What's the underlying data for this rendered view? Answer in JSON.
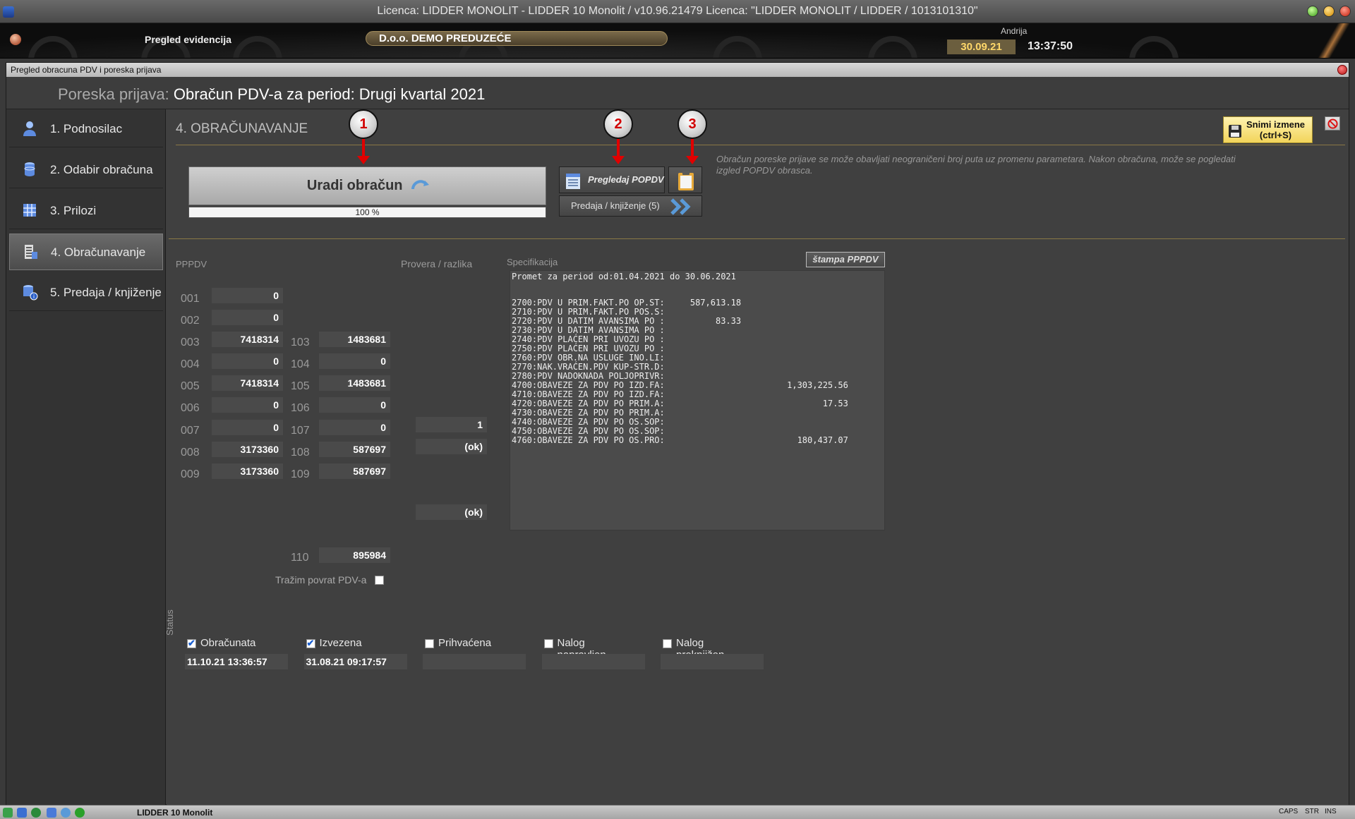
{
  "titlebar": {
    "title": "Licenca: LIDDER MONOLIT - LIDDER 10 Monolit / v10.96.21479 Licenca: \"LIDDER MONOLIT / LIDDER / 1013101310\""
  },
  "header": {
    "section": "Pregled evidencija",
    "company": "D.o.o. DEMO PREDUZEĆE",
    "user": "Andrija",
    "date": "30.09.21",
    "time": "13:37:50"
  },
  "window": {
    "title": "Pregled obracuna PDV i poreska prijava",
    "heading_label": "Poreska prijava:",
    "heading_value": "Obračun PDV-a za period: Drugi kvartal 2021"
  },
  "sidebar": {
    "items": [
      {
        "label": "1. Podnosilac",
        "icon": "person-icon"
      },
      {
        "label": "2. Odabir obračuna",
        "icon": "database-icon"
      },
      {
        "label": "3. Prilozi",
        "icon": "table-icon"
      },
      {
        "label": "4. Obračunavanje",
        "icon": "calculator-list-icon"
      },
      {
        "label": "5. Predaja / knjiženje",
        "icon": "database-info-icon"
      }
    ]
  },
  "main": {
    "section_title": "4. OBRAČUNAVANJE",
    "save_label_1": "Snimi izmene",
    "save_label_2": "(ctrl+S)",
    "calc_button": "Uradi obračun",
    "progress_text": "100 %",
    "progress": 1.0,
    "review_button": "Pregledaj POPDV",
    "submit_button": "Predaja / knjiženje (5)",
    "info_line1": "Obračun poreske prijave se može obavljati neograničeni broj puta uz promenu parametara. Nakon obračuna, može se pogledati",
    "info_line2": "izgled POPDV obrasca.",
    "markers": [
      "1",
      "2",
      "3"
    ]
  },
  "pppdv": {
    "label": "PPPDV",
    "check_label": "Provera / razlika",
    "rows_left": [
      {
        "code": "001",
        "value": "0"
      },
      {
        "code": "002",
        "value": "0"
      },
      {
        "code": "003",
        "value": "7418314"
      },
      {
        "code": "004",
        "value": "0"
      },
      {
        "code": "005",
        "value": "7418314"
      },
      {
        "code": "006",
        "value": "0"
      },
      {
        "code": "007",
        "value": "0"
      },
      {
        "code": "008",
        "value": "3173360"
      },
      {
        "code": "009",
        "value": "3173360"
      }
    ],
    "rows_right": [
      {
        "code": "103",
        "value": "1483681"
      },
      {
        "code": "104",
        "value": "0"
      },
      {
        "code": "105",
        "value": "1483681"
      },
      {
        "code": "106",
        "value": "0"
      },
      {
        "code": "107",
        "value": "0"
      },
      {
        "code": "108",
        "value": "587697"
      },
      {
        "code": "109",
        "value": "587697"
      }
    ],
    "row_110": {
      "code": "110",
      "value": "895984"
    },
    "checks": {
      "r105": "1",
      "r106": "(ok)",
      "r109": "(ok)"
    },
    "refund_label": "Tražim povrat PDV-a"
  },
  "spec": {
    "label": "Specifikacija",
    "print_button": "štampa PPPDV",
    "lines": [
      "Promet za period od:01.04.2021 do 30.06.2021",
      "",
      "2700:PDV U PRIM.FAKT.PO OP.ST:     587,613.18",
      "2710:PDV U PRIM.FAKT.PO POS.S:",
      "2720:PDV U DATIM AVANSIMA PO :          83.33",
      "2730:PDV U DATIM AVANSIMA PO :",
      "2740:PDV PLAĆEN PRI UVOZU PO :",
      "2750:PDV PLAĆEN PRI UVOZU PO :",
      "2760:PDV OBR.NA USLUGE INO.LI:",
      "2770:NAK.VRAĆEN.PDV KUP-STR.D:",
      "2780:PDV NADOKNADA POLJOPRIVR:",
      "4700:OBAVEZE ZA PDV PO IZD.FA:                        1,303,225.56",
      "4710:OBAVEZE ZA PDV PO IZD.FA:",
      "4720:OBAVEZE ZA PDV PO PRIM.A:                               17.53",
      "4730:OBAVEZE ZA PDV PO PRIM.A:",
      "4740:OBAVEZE ZA PDV PO OS.SOP:",
      "4750:OBAVEZE ZA PDV PO OS.SOP:",
      "4760:OBAVEZE ZA PDV PO OS.PRO:                          180,437.07"
    ]
  },
  "status": {
    "label": "Status",
    "items": [
      {
        "label": "Obračunata",
        "checked": true,
        "value": "11.10.21 13:36:57"
      },
      {
        "label": "Izvezena",
        "checked": true,
        "value": "31.08.21 09:17:57"
      },
      {
        "label": "Prihvaćena",
        "checked": false,
        "value": ""
      },
      {
        "label": "Nalog napravljen",
        "checked": false,
        "value": ""
      },
      {
        "label": "Nalog proknjižen",
        "checked": false,
        "value": ""
      }
    ]
  },
  "taskbar": {
    "app": "LIDDER 10 Monolit",
    "caps": "CAPS",
    "str": "STR",
    "ins": "INS"
  }
}
